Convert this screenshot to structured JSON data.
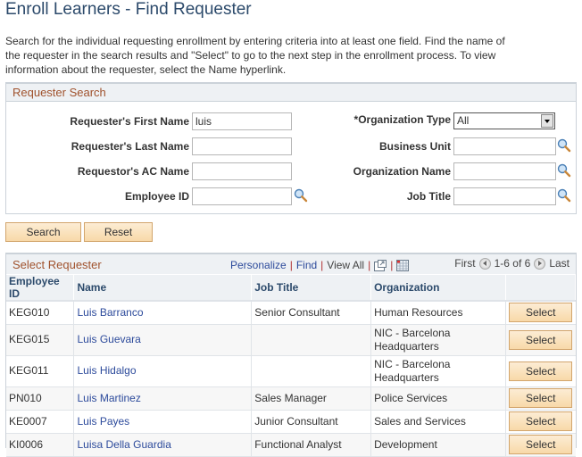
{
  "page": {
    "title": "Enroll Learners - Find Requester",
    "instructions": "Search for the individual requesting enrollment by entering criteria into at least one field. Find the name of the requester in the search results and \"Select\" to go to the next step in the enrollment process. To view information about the requester, select the Name hyperlink."
  },
  "search": {
    "header": "Requester Search",
    "first_name_label": "Requester's First Name",
    "first_name_value": "luis",
    "last_name_label": "Requester's Last Name",
    "last_name_value": "",
    "ac_name_label": "Requestor's AC Name",
    "ac_name_value": "",
    "employee_id_label": "Employee ID",
    "employee_id_value": "",
    "org_type_label": "*Organization Type",
    "org_type_value": "All",
    "business_unit_label": "Business Unit",
    "business_unit_value": "",
    "org_name_label": "Organization Name",
    "org_name_value": "",
    "job_title_label": "Job Title",
    "job_title_value": "",
    "search_button": "Search",
    "reset_button": "Reset"
  },
  "grid": {
    "title": "Select Requester",
    "personalize": "Personalize",
    "find": "Find",
    "view_all": "View All",
    "first": "First",
    "range": "1-6 of 6",
    "last": "Last",
    "columns": [
      "Employee ID",
      "Name",
      "Job Title",
      "Organization",
      ""
    ],
    "rows": [
      {
        "id": "KEG010",
        "name": "Luis Barranco",
        "job": "Senior Consultant",
        "org": "Human Resources",
        "action": "Select"
      },
      {
        "id": "KEG015",
        "name": "Luis Guevara",
        "job": "",
        "org": "NIC - Barcelona Headquarters",
        "action": "Select"
      },
      {
        "id": "KEG011",
        "name": "Luis Hidalgo",
        "job": "",
        "org": "NIC - Barcelona Headquarters",
        "action": "Select"
      },
      {
        "id": "PN010",
        "name": "Luis Martinez",
        "job": "Sales Manager",
        "org": "Police Services",
        "action": "Select"
      },
      {
        "id": "KE0007",
        "name": "Luis Payes",
        "job": "Junior Consultant",
        "org": "Sales and Services",
        "action": "Select"
      },
      {
        "id": "KI0006",
        "name": "Luisa Della Guardia",
        "job": "Functional Analyst",
        "org": "Development",
        "action": "Select"
      }
    ]
  },
  "icons": {
    "lookup": "magnifier-lookup-icon",
    "zoom_grid": "new-window-icon",
    "download": "spreadsheet-download-icon",
    "prev": "previous-page-icon",
    "next": "next-page-icon"
  }
}
